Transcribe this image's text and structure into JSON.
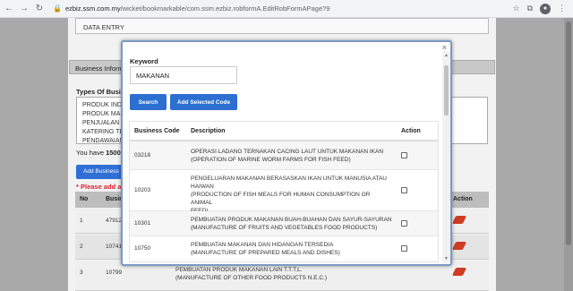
{
  "browser": {
    "url_host": "ezbiz.ssm.com.my",
    "url_path": "/wicket/bookmarkable/com.ssm.ezbiz.robformA.EditRobFormAPage?9",
    "nav_back": "←",
    "nav_forward": "→",
    "nav_reload": "↻",
    "lock": "🔒",
    "star": "☆",
    "extensions": "⧉",
    "avatar": "●",
    "menu": "⋮"
  },
  "background": {
    "data_entry": "DATA ENTRY",
    "business_info_header": "Business Informa",
    "types_label": "Types Of Busine",
    "types_text": [
      "PRODUK INDI",
      "PRODUK MA",
      "PENJUALAN",
      "KATERING TE",
      "PENDAWAIAN"
    ],
    "you_have_prefix": "You have ",
    "you_have_value": "1500",
    "add_business_button": "Add Business",
    "please_add": "* Please add a",
    "table_headers": {
      "no": "No",
      "business": "Busin",
      "action": "Action"
    },
    "rows": [
      {
        "no": "1",
        "code": "47912"
      },
      {
        "no": "2",
        "code": "10741"
      },
      {
        "no": "3",
        "code": "10799"
      }
    ],
    "bottom_text": [
      "PEMBUATAN PRODUK MAKANAN LAIN T.T.T.L.",
      "(MANUFACTURE OF OTHER FOOD PRODUCTS N.E.C.)"
    ]
  },
  "modal": {
    "close": "×",
    "keyword_label": "Keyword",
    "keyword_value": "MAKANAN",
    "search_button": "Search",
    "add_selected_button": "Add Selected Code",
    "columns": {
      "code": "Business Code",
      "description": "Description",
      "action": "Action"
    },
    "results": [
      {
        "code": "03218",
        "desc": [
          "OPERASI LADANG TERNAKAN CACING LAUT UNTUK MAKANAN IKAN",
          "(OPERATION OF MARINE WORM FARMS FOR FISH FEED)"
        ]
      },
      {
        "code": "10203",
        "desc": [
          "PENGELUARAN MAKANAN BERASASKAN IKAN UNTUK MANUSIA ATAU",
          "HAIWAN",
          "(PRODUCTION OF FISH MEALS FOR HUMAN CONSUMPTION OR ANIMAL",
          "FEED)"
        ]
      },
      {
        "code": "10301",
        "desc": [
          "PEMBUATAN PRODUK MAKANAN BUAH-BUAHAN DAN SAYUR-SAYURAN",
          "(MANUFACTURE OF FRUITS AND VEGETABLES FOOD PRODUCTS)"
        ]
      },
      {
        "code": "10750",
        "desc": [
          "PEMBUATAN MAKANAN DAN HIDANGAN TERSEDIA",
          "(MANUFACTURE OF PREPARED MEALS AND DISHES)"
        ]
      }
    ]
  }
}
